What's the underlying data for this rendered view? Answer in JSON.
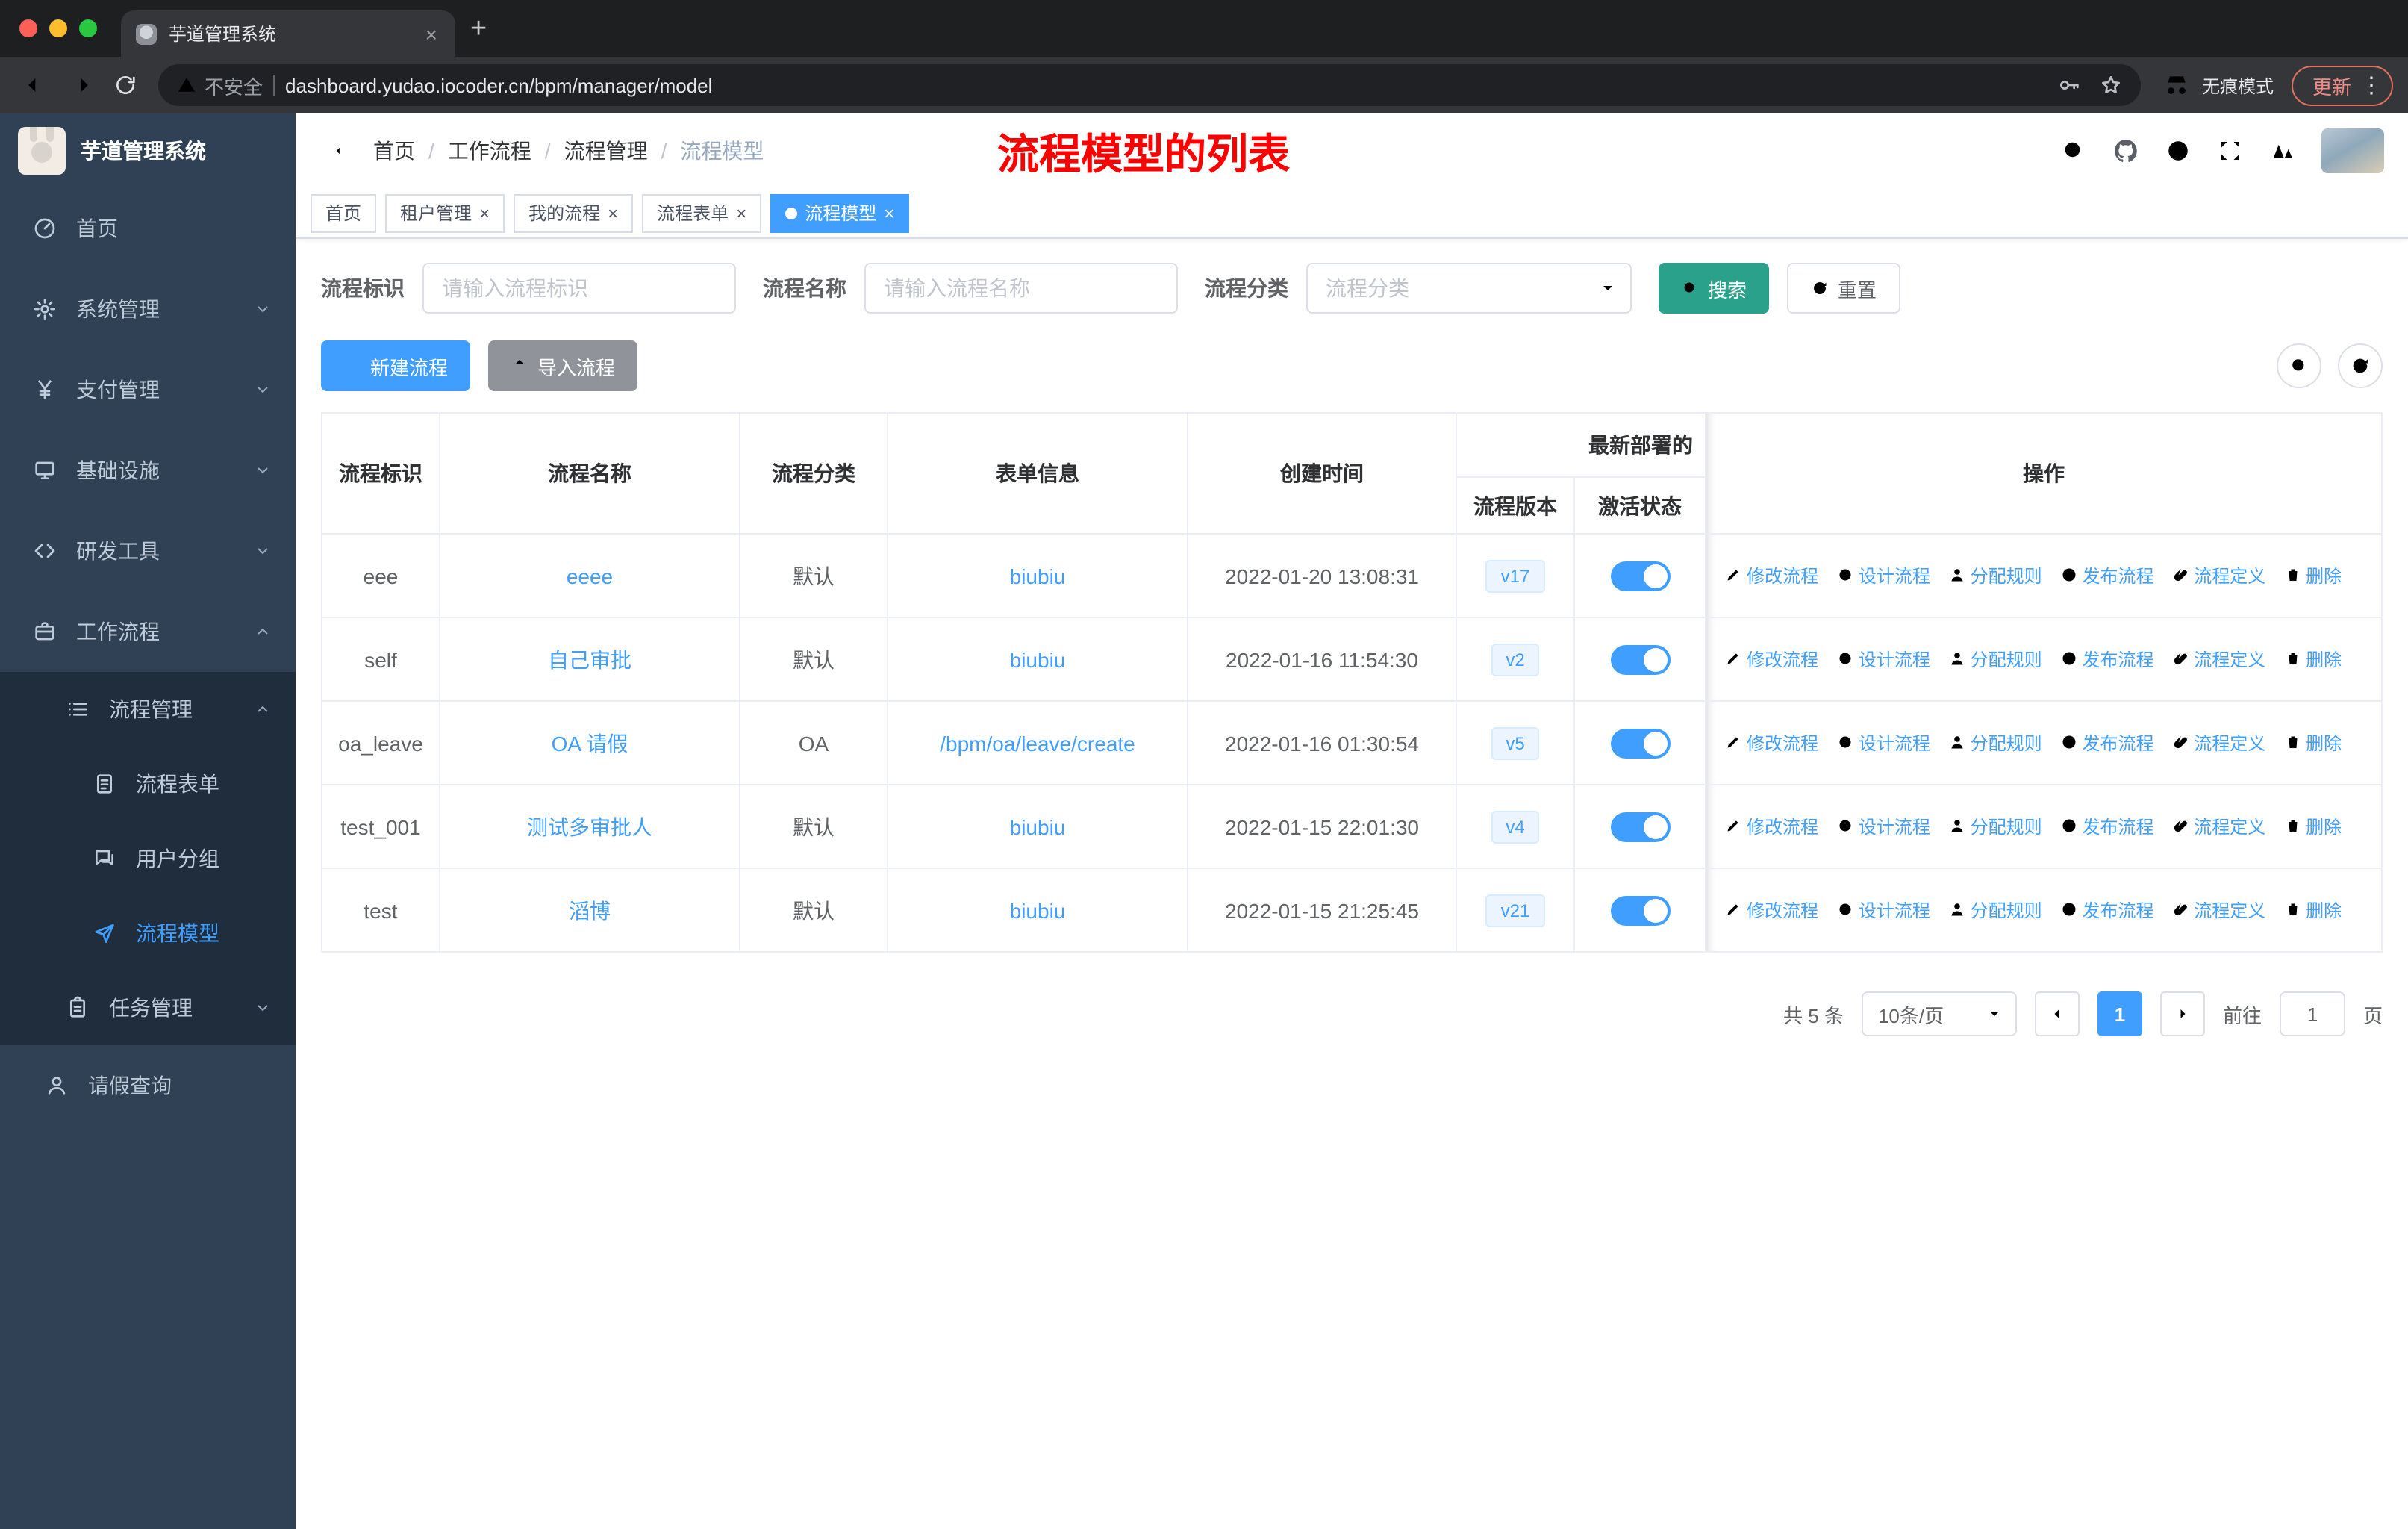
{
  "browser": {
    "tab_title": "芋道管理系统",
    "security_label": "不安全",
    "url": "dashboard.yudao.iocoder.cn/bpm/manager/model",
    "incognito_label": "无痕模式",
    "update_label": "更新"
  },
  "icons": {
    "close": "×",
    "new_tab": "+",
    "menu_dots": "⋮"
  },
  "sidebar": {
    "logo_title": "芋道管理系统",
    "items": {
      "home": "首页",
      "system": "系统管理",
      "payment": "支付管理",
      "infra": "基础设施",
      "devtools": "研发工具",
      "workflow": "工作流程",
      "process_mgmt": "流程管理",
      "process_form": "流程表单",
      "user_group": "用户分组",
      "process_model": "流程模型",
      "task_mgmt": "任务管理",
      "leave_query": "请假查询"
    }
  },
  "header": {
    "breadcrumb": [
      "首页",
      "工作流程",
      "流程管理",
      "流程模型"
    ],
    "annotation": "流程模型的列表"
  },
  "tags": {
    "home": "首页",
    "tenant": "租户管理",
    "my_process": "我的流程",
    "process_form": "流程表单",
    "process_model": "流程模型"
  },
  "filters": {
    "key_label": "流程标识",
    "key_placeholder": "请输入流程标识",
    "name_label": "流程名称",
    "name_placeholder": "请输入流程名称",
    "category_label": "流程分类",
    "category_placeholder": "流程分类",
    "search_label": "搜索",
    "reset_label": "重置"
  },
  "toolbar": {
    "create_label": "新建流程",
    "import_label": "导入流程"
  },
  "table": {
    "columns": {
      "key": "流程标识",
      "name": "流程名称",
      "category": "流程分类",
      "form": "表单信息",
      "created": "创建时间",
      "deploy_group": "最新部署的",
      "version": "流程版本",
      "active": "激活状态",
      "actions": "操作"
    },
    "actions": [
      "修改流程",
      "设计流程",
      "分配规则",
      "发布流程",
      "流程定义",
      "删除"
    ],
    "rows": [
      {
        "key": "eee",
        "name": "eeee",
        "category": "默认",
        "form": "biubiu",
        "created": "2022-01-20 13:08:31",
        "version": "v17",
        "active": true
      },
      {
        "key": "self",
        "name": "自己审批",
        "category": "默认",
        "form": "biubiu",
        "created": "2022-01-16 11:54:30",
        "version": "v2",
        "active": true
      },
      {
        "key": "oa_leave",
        "name": "OA 请假",
        "category": "OA",
        "form": "/bpm/oa/leave/create",
        "created": "2022-01-16 01:30:54",
        "version": "v5",
        "active": true
      },
      {
        "key": "test_001",
        "name": "测试多审批人",
        "category": "默认",
        "form": "biubiu",
        "created": "2022-01-15 22:01:30",
        "version": "v4",
        "active": true
      },
      {
        "key": "test",
        "name": "滔博",
        "category": "默认",
        "form": "biubiu",
        "created": "2022-01-15 21:25:45",
        "version": "v21",
        "active": true
      }
    ]
  },
  "pagination": {
    "total": "共 5 条",
    "page_size": "10条/页",
    "current_page": "1",
    "goto_label": "前往",
    "goto_value": "1",
    "unit_label": "页"
  },
  "colors": {
    "primary": "#409eff",
    "sidebar_bg": "#304156",
    "submenu_bg": "#1f2d3d",
    "search_button": "#2aa18b",
    "annotation_red": "#fe0000",
    "version_tag_bg": "#ecf5ff"
  }
}
